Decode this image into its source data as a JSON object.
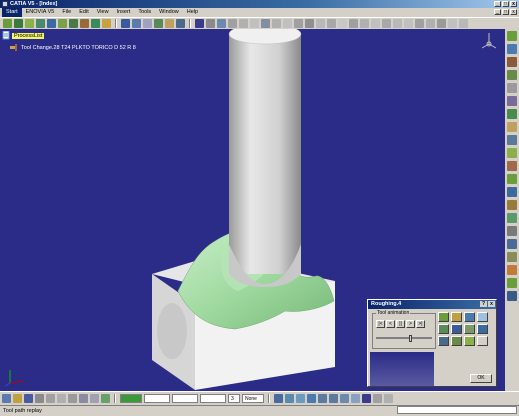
{
  "window": {
    "title": "CATIA V5 - [Index]"
  },
  "menu": [
    "Start",
    "ENOVIA V5",
    "File",
    "Edit",
    "View",
    "Insert",
    "Tools",
    "Window",
    "Help"
  ],
  "tree": {
    "root": "ProcessList",
    "child": "Tool Change.28  T24 PLKTO TORICO D 52 R 8"
  },
  "dialog": {
    "title": "Roughing.4",
    "group_label": "Tool animation",
    "play_buttons": [
      "|<",
      "<",
      "||",
      ">",
      ">|"
    ],
    "slider_fraction": 0.62,
    "ok_label": "OK"
  },
  "toolbar_bottom": {
    "combo_units": "None",
    "combo_number": "3"
  },
  "status": {
    "text": "Tool path replay"
  },
  "colors": {
    "viewport": "#2b2b88",
    "stock": "#ececec",
    "machined": "#9fd99f",
    "tool": "#d8d8d8"
  }
}
